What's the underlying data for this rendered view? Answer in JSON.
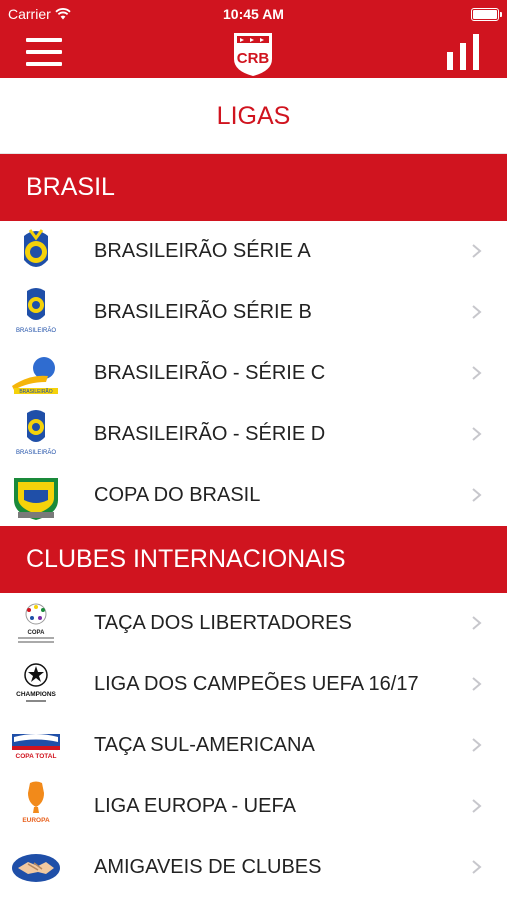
{
  "status_bar": {
    "carrier": "Carrier",
    "time": "10:45 AM"
  },
  "header": {
    "logo_text": "CRB"
  },
  "page_title": "LIGAS",
  "sections": [
    {
      "title": "BRASIL",
      "items": [
        {
          "label": "BRASILEIRÃO SÉRIE A",
          "icon": "brasileirao-serie-a-logo"
        },
        {
          "label": "BRASILEIRÃO SÉRIE B",
          "icon": "brasileirao-serie-b-logo",
          "icon_text": "BRASILEIRÃO"
        },
        {
          "label": "BRASILEIRÃO - SÉRIE C",
          "icon": "brasileirao-serie-c-logo",
          "icon_text": "BRASILEIRÃO"
        },
        {
          "label": "BRASILEIRÃO - SÉRIE D",
          "icon": "brasileirao-serie-d-logo",
          "icon_text": "BRASILEIRÃO"
        },
        {
          "label": "COPA DO BRASIL",
          "icon": "copa-do-brasil-logo"
        }
      ]
    },
    {
      "title": "CLUBES INTERNACIONAIS",
      "items": [
        {
          "label": "TAÇA DOS LIBERTADORES",
          "icon": "libertadores-logo",
          "icon_text": "COPA"
        },
        {
          "label": "LIGA DOS CAMPEÕES UEFA 16/17",
          "icon": "champions-league-logo",
          "icon_text": "CHAMPIONS"
        },
        {
          "label": "TAÇA SUL-AMERICANA",
          "icon": "sudamericana-logo",
          "icon_text": "COPA TOTAL"
        },
        {
          "label": "LIGA EUROPA - UEFA",
          "icon": "europa-league-logo",
          "icon_text": "EUROPA"
        },
        {
          "label": "AMIGAVEIS DE CLUBES",
          "icon": "handshake-logo"
        }
      ]
    }
  ],
  "colors": {
    "brand_red": "#d0141f",
    "text": "#222222",
    "chevron": "#c7c7cc"
  }
}
